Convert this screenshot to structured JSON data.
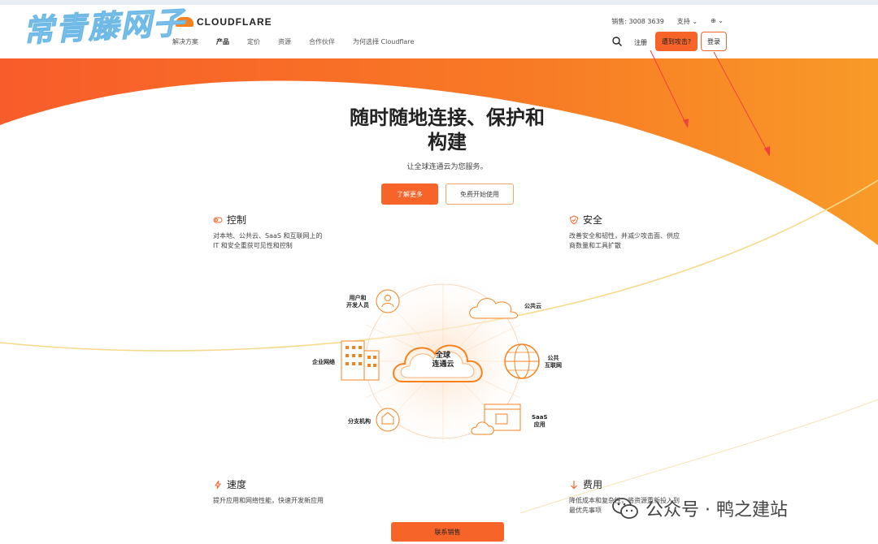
{
  "watermark": "常青藤网子",
  "header": {
    "logo_text": "CLOUDFLARE",
    "nav": [
      "解决方案",
      "产品",
      "定价",
      "资源",
      "合作伙伴",
      "为何选择 Cloudflare"
    ],
    "sales_phone": "销售: 3008 3639",
    "support": "支持",
    "signup": "注册",
    "attack_button": "遭到攻击?",
    "login_button": "登录"
  },
  "hero": {
    "title_line1": "随时随地连接、保护和",
    "title_line2": "构建",
    "subtitle": "让全球连通云为您服务。",
    "learn_more": "了解更多",
    "free_start": "免费开始使用"
  },
  "features": {
    "control": {
      "title": "控制",
      "desc1": "对本地、公共云、SaaS 和互联网上的",
      "desc2": "IT 和安全重获可见性和控制"
    },
    "security": {
      "title": "安全",
      "desc1": "改善安全和韧性，并减少攻击面、供应",
      "desc2": "商数量和工具扩散"
    },
    "speed": {
      "title": "速度",
      "desc1": "提升应用和网络性能，快速开发新应用"
    },
    "cost": {
      "title": "费用",
      "desc1": "降低成本和复杂性，将资源重新投入到",
      "desc2": "最优先事项"
    }
  },
  "diagram": {
    "center_line1": "全球",
    "center_line2": "连通云",
    "user_dev_line1": "用户和",
    "user_dev_line2": "开发人员",
    "public_cloud": "公共云",
    "enterprise_network": "企业网络",
    "public_internet_line1": "公共",
    "public_internet_line2": "互联网",
    "branch": "分支机构",
    "saas_line1": "SaaS",
    "saas_line2": "应用"
  },
  "contact_button": "联系销售",
  "wechat_caption": "公众号 · 鸭之建站",
  "colors": {
    "accent": "#f6642a",
    "orange": "#f6821f",
    "watermark": "#8ecdf0"
  }
}
